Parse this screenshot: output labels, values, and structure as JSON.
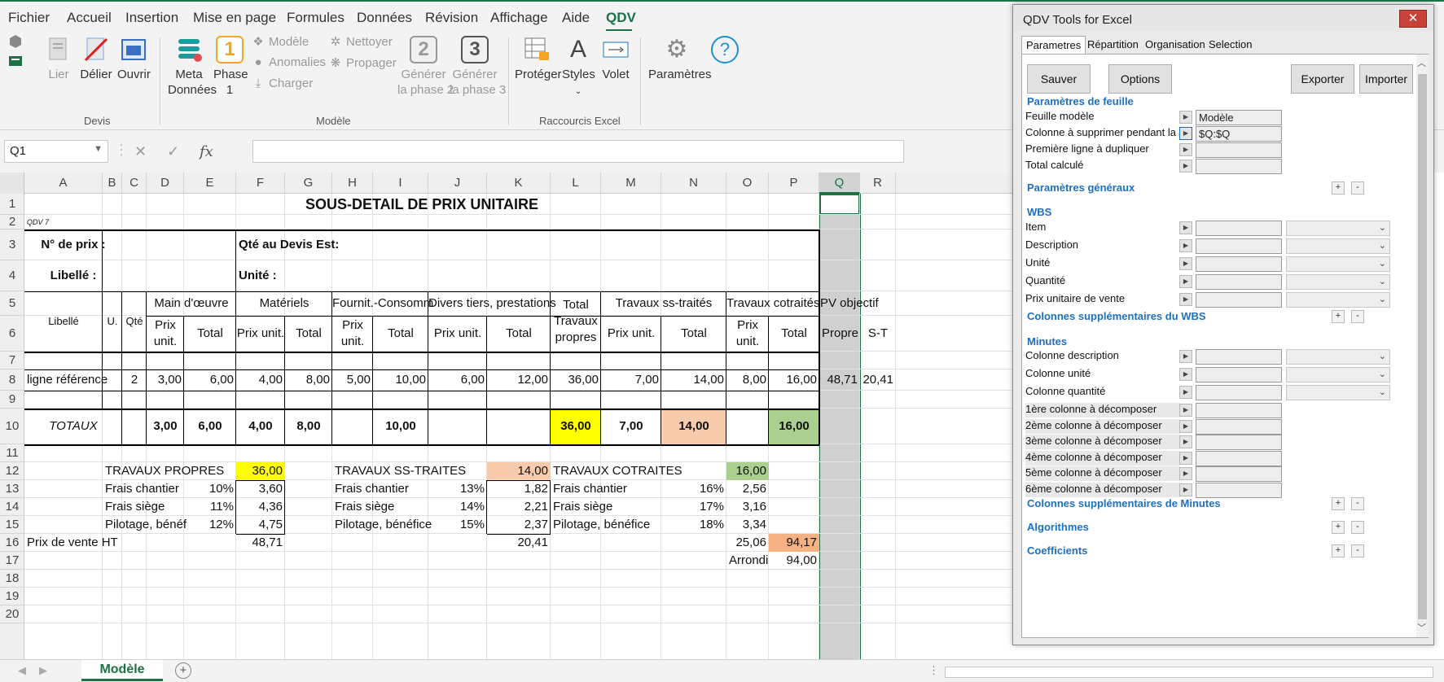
{
  "menu": {
    "items": [
      "Fichier",
      "Accueil",
      "Insertion",
      "Mise en page",
      "Formules",
      "Données",
      "Révision",
      "Affichage",
      "Aide",
      "QDV"
    ]
  },
  "ribbon": {
    "devis": {
      "lier": "Lier",
      "delier": "Délier",
      "ouvrir": "Ouvrir",
      "group": "Devis"
    },
    "modele": {
      "meta1": "Meta",
      "meta2": "Données",
      "phase1a": "Phase",
      "phase1b": "1",
      "phase1_icon": "1",
      "modele": "Modèle",
      "anomalies": "Anomalies",
      "charger": "Charger",
      "nettoyer": "Nettoyer",
      "propager": "Propager",
      "gen2a": "Générer",
      "gen2b": "la phase 2",
      "gen2_icon": "2",
      "gen3a": "Générer",
      "gen3b": "la phase 3",
      "gen3_icon": "3",
      "group": "Modèle"
    },
    "raccourcis": {
      "proteger": "Protéger",
      "styles": "Styles",
      "volet": "Volet",
      "group": "Raccourcis Excel"
    },
    "parametres": "Paramètres"
  },
  "formula_bar": {
    "name": "Q1",
    "fx": "fx"
  },
  "columns": [
    {
      "l": "A",
      "w": 96
    },
    {
      "l": "B",
      "w": 24
    },
    {
      "l": "C",
      "w": 30
    },
    {
      "l": "D",
      "w": 46
    },
    {
      "l": "E",
      "w": 64
    },
    {
      "l": "F",
      "w": 60
    },
    {
      "l": "G",
      "w": 58
    },
    {
      "l": "H",
      "w": 50
    },
    {
      "l": "I",
      "w": 68
    },
    {
      "l": "J",
      "w": 72
    },
    {
      "l": "K",
      "w": 78
    },
    {
      "l": "L",
      "w": 62
    },
    {
      "l": "M",
      "w": 74
    },
    {
      "l": "N",
      "w": 80
    },
    {
      "l": "O",
      "w": 52
    },
    {
      "l": "P",
      "w": 62
    },
    {
      "l": "Q",
      "w": 50
    },
    {
      "l": "R",
      "w": 44
    }
  ],
  "rows": [
    "1",
    "2",
    "3",
    "4",
    "5",
    "6",
    "7",
    "8",
    "9",
    "10",
    "11",
    "12",
    "13",
    "14",
    "15",
    "16",
    "17",
    "18",
    "19",
    "20"
  ],
  "sheet": {
    "title": "SOUS-DETAIL DE PRIX UNITAIRE",
    "qdv": "QDV 7",
    "no_prix": "N° de prix :",
    "qte_devis": "Qté au Devis Est:",
    "libelle": "Libellé :",
    "unite": "Unité :",
    "h_libelle": "Libellé",
    "h_u": "U.",
    "h_qte": "Qté",
    "h_mo": "Main d'œuvre",
    "h_mat": "Matériels",
    "h_four": "Fournit.-Consomm",
    "h_div": "Divers tiers, prestations",
    "h_total_tp": "Total Travaux propres",
    "h_tst": "Travaux ss-traités",
    "h_tco": "Travaux cotraités",
    "h_pv": "PV objectif",
    "prix_unit": "Prix unit.",
    "prix_unit2": "Prix unit.",
    "total": "Total",
    "propre": "Propre",
    "st": "S-T",
    "ref": {
      "lib": "ligne référence",
      "qte": "2",
      "d": "3,00",
      "e": "6,00",
      "f": "4,00",
      "g": "8,00",
      "h": "5,00",
      "i": "10,00",
      "j": "6,00",
      "k": "12,00",
      "l": "36,00",
      "m": "7,00",
      "n": "14,00",
      "o": "8,00",
      "p": "16,00",
      "q": "48,71",
      "r": "20,41"
    },
    "tot": {
      "lib": "TOTAUX",
      "d": "3,00",
      "e": "6,00",
      "f": "4,00",
      "g": "8,00",
      "i": "10,00",
      "l": "36,00",
      "m": "7,00",
      "n": "14,00",
      "p": "16,00"
    },
    "tp": {
      "label": "TRAVAUX PROPRES",
      "val": "36,00",
      "fc": "Frais chantier",
      "fc_pct": "10%",
      "fc_v": "3,60",
      "fs": "Frais siège",
      "fs_pct": "11%",
      "fs_v": "4,36",
      "pb": "Pilotage, bénéf",
      "pb_pct": "12%",
      "pb_v": "4,75"
    },
    "st_block": {
      "label": "TRAVAUX SS-TRAITES",
      "val": "14,00",
      "fc": "Frais chantier",
      "fc_pct": "13%",
      "fc_v": "1,82",
      "fs": "Frais siège",
      "fs_pct": "14%",
      "fs_v": "2,21",
      "pb": "Pilotage, bénéfice",
      "pb_pct": "15%",
      "pb_v": "2,37"
    },
    "co_block": {
      "label": "TRAVAUX COTRAITES",
      "val": "16,00",
      "fc": "Frais chantier",
      "fc_pct": "16%",
      "fc_v": "2,56",
      "fs": "Frais siège",
      "fs_pct": "17%",
      "fs_v": "3,16",
      "pb": "Pilotage, bénéfice",
      "pb_pct": "18%",
      "pb_v": "3,34"
    },
    "pv": {
      "label": "Prix de vente HT",
      "f": "48,71",
      "k": "20,41",
      "o": "25,06",
      "p": "94,17"
    },
    "arrondi": {
      "label": "Arrondi",
      "val": "94,00"
    }
  },
  "tabs": {
    "sheet": "Modèle",
    "add": "+"
  },
  "panel": {
    "title": "QDV Tools for Excel",
    "close": "✕",
    "tabs": [
      "Parametres",
      "Répartition",
      "Organisation",
      "Selection"
    ],
    "buttons": {
      "sauver": "Sauver",
      "options": "Options",
      "exporter": "Exporter",
      "importer": "Importer"
    },
    "sec_feuille": "Paramètres de feuille",
    "feuille_rows": [
      {
        "label": "Feuille modèle",
        "value": "Modèle"
      },
      {
        "label": "Colonne à supprimer pendant la co",
        "value": "$Q:$Q"
      },
      {
        "label": "Première ligne à dupliquer",
        "value": ""
      },
      {
        "label": "Total calculé",
        "value": ""
      }
    ],
    "sec_generaux": "Paramètres généraux",
    "sec_wbs": "WBS",
    "wbs_rows": [
      "Item",
      "Description",
      "Unité",
      "Quantité",
      "Prix unitaire de vente"
    ],
    "sec_wbs_sup": "Colonnes supplémentaires du WBS",
    "sec_minutes": "Minutes",
    "minutes_rows": [
      "Colonne description",
      "Colonne unité",
      "Colonne quantité"
    ],
    "decomp_rows": [
      "1ère colonne à décomposer",
      "2ème colonne à décomposer",
      "3ème colonne à décomposer",
      "4ème colonne à décomposer",
      "5ème colonne à décomposer",
      "6ème colonne à décomposer"
    ],
    "sec_min_sup": "Colonnes supplémentaires de Minutes",
    "sec_algo": "Algorithmes",
    "sec_coef": "Coefficients",
    "plus": "+",
    "minus": "-"
  },
  "colors": {
    "accent": "#1e7145",
    "yellow": "#ffff00",
    "peach": "#f8cbad",
    "green": "#a9d08e",
    "orange": "#f4b183",
    "grey": "#d0d0d0",
    "panel_link": "#1f6fc1"
  }
}
